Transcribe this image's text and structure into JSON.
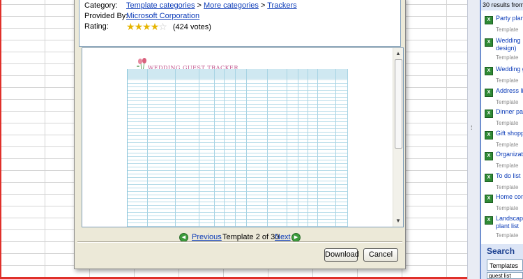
{
  "details": {
    "category_label": "Category:",
    "category_path": [
      "Template categories",
      "More categories",
      "Trackers"
    ],
    "category_separator": ">",
    "provided_label": "Provided By:",
    "provided_value": "Microsoft Corporation",
    "rating_label": "Rating:",
    "rating_stars": 4,
    "rating_max": 5,
    "votes": "(424 votes)"
  },
  "preview": {
    "template_title": "WEDDING GUEST TRACKER"
  },
  "navigation": {
    "previous": "Previous",
    "position": "Template 2 of 30",
    "next": "Next"
  },
  "buttons": {
    "download": "Download",
    "cancel": "Cancel"
  },
  "task_pane": {
    "results_header": "30 results from",
    "items": [
      {
        "name": "Party plan",
        "sub": "Template"
      },
      {
        "name": "Wedding",
        "name2": "design)",
        "sub": "Template"
      },
      {
        "name": "Wedding g",
        "sub": "Template"
      },
      {
        "name": "Address li",
        "sub": "Template"
      },
      {
        "name": "Dinner pa",
        "sub": "Template"
      },
      {
        "name": "Gift shopp",
        "sub": "Template"
      },
      {
        "name": "Organizat",
        "sub": "Template"
      },
      {
        "name": "To do list",
        "sub": "Template"
      },
      {
        "name": "Home con",
        "sub": "Template"
      },
      {
        "name": "Landscap",
        "name2": "plant list",
        "sub": "Template"
      }
    ],
    "search_title": "Search",
    "search_scope": "Templates",
    "search_query": "guest list"
  },
  "colors": {
    "link": "#0b3bb8",
    "dialog_bg": "#ece9d8",
    "template_accent": "#c0508a",
    "pane_bg": "#6f8fcf"
  }
}
